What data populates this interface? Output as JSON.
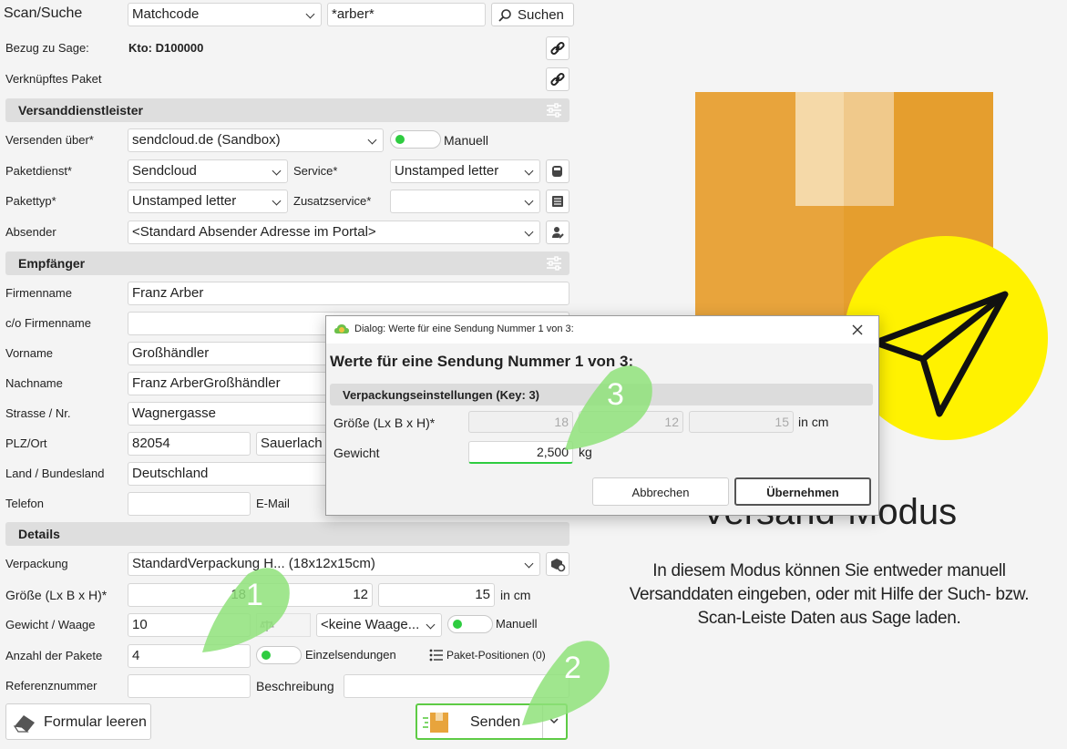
{
  "scan": {
    "label": "Scan/Suche",
    "mode": "Matchcode",
    "query": "*arber*",
    "search_button": "Suchen"
  },
  "sage": {
    "label": "Bezug zu Sage:",
    "value": "Kto: D100000"
  },
  "linked": {
    "label": "Verknüpftes Paket"
  },
  "section_carrier": {
    "title": "Versanddienstleister"
  },
  "carrier": {
    "send_via_label": "Versenden über*",
    "send_via": "sendcloud.de (Sandbox)",
    "manual_label": "Manuell",
    "service_provider_label": "Paketdienst*",
    "service_provider": "Sendcloud",
    "service_label": "Service*",
    "service": "Unstamped letter",
    "package_type_label": "Pakettyp*",
    "package_type": "Unstamped letter",
    "extra_service_label": "Zusatzservice*",
    "extra_service": "",
    "sender_label": "Absender",
    "sender": "<Standard Absender Adresse im Portal>"
  },
  "section_recipient": {
    "title": "Empfänger"
  },
  "recipient": {
    "company_label": "Firmenname",
    "company": "Franz Arber",
    "co_label": "c/o Firmenname",
    "co": "",
    "first_label": "Vorname",
    "first": "Großhändler",
    "last_label": "Nachname",
    "last": "Franz ArberGroßhändler",
    "street_label": "Strasse / Nr.",
    "street": "Wagnergasse",
    "city_label": "PLZ/Ort",
    "zip": "82054",
    "city": "Sauerlach",
    "country_label": "Land / Bundesland",
    "country": "Deutschland",
    "phone_label": "Telefon",
    "phone": "",
    "email_label": "E-Mail"
  },
  "section_details": {
    "title": "Details"
  },
  "details": {
    "packaging_label": "Verpackung",
    "packaging": "StandardVerpackung H... (18x12x15cm)",
    "size_label": "Größe (Lx B x H)*",
    "l": "18",
    "b": "12",
    "h": "15",
    "unit": "in cm",
    "weight_label": "Gewicht / Waage",
    "weight": "10",
    "scale": "<keine Waage...",
    "manual_label": "Manuell",
    "count_label": "Anzahl der Pakete",
    "count": "4",
    "single_label": "Einzelsendungen",
    "positions_label": "Paket-Positionen (0)",
    "ref_label": "Referenznummer",
    "ref": "",
    "desc_label": "Beschreibung",
    "desc": ""
  },
  "footer": {
    "clear_button": "Formular leeren",
    "send_button": "Senden"
  },
  "dialog": {
    "title": "Dialog: Werte für eine Sendung Nummer 1 von 3:",
    "heading": "Werte für eine Sendung Nummer 1 von 3:",
    "section": "Verpackungseinstellungen (Key: 3)",
    "size_label": "Größe (Lx B x H)*",
    "l": "18",
    "b": "12",
    "h": "15",
    "unit": "in cm",
    "weight_label": "Gewicht",
    "weight": "2,500",
    "weight_unit": "kg",
    "cancel": "Abbrechen",
    "apply": "Übernehmen"
  },
  "markers": {
    "m1": "1",
    "m2": "2",
    "m3": "3"
  },
  "promo": {
    "title": "Versand-Modus",
    "text1": "In diesem Modus können Sie entweder manuell",
    "text2": "Versanddaten eingeben, oder  mit Hilfe der Such- bzw.",
    "text3": "Scan-Leiste Daten aus Sage laden."
  },
  "colors": {
    "accent_green": "#2ecc40",
    "marker_green": "#8fe27a",
    "box_orange": "#e8a43c",
    "sun_yellow": "#fff200"
  }
}
